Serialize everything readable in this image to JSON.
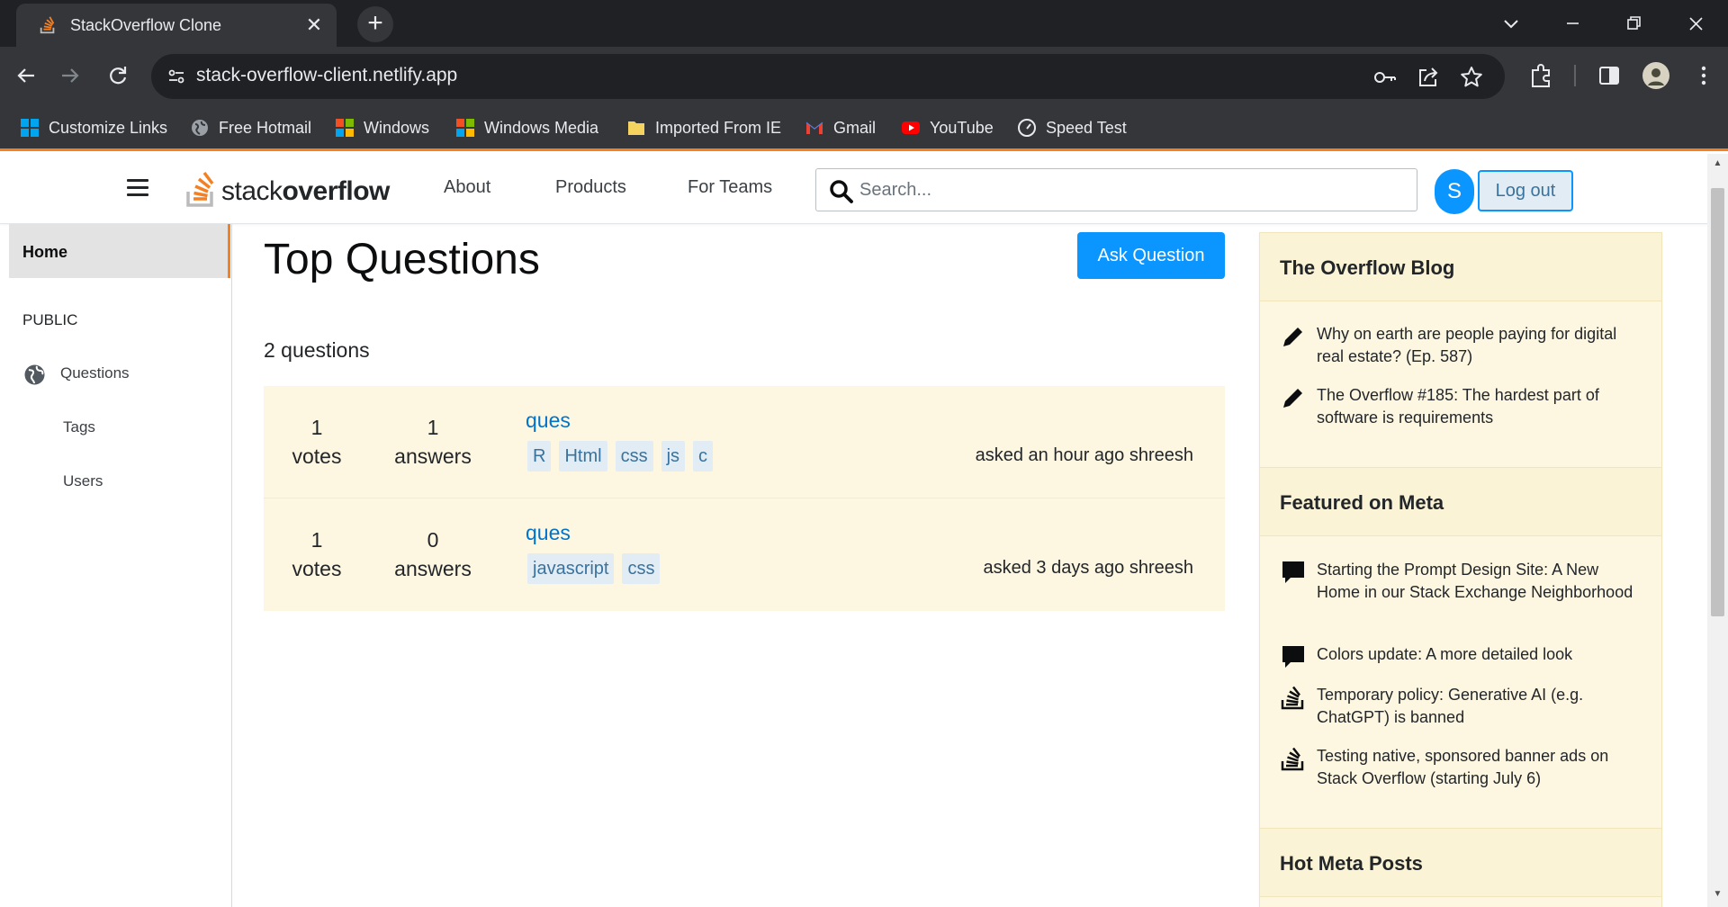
{
  "browser": {
    "tab_title": "StackOverflow Clone",
    "tab_close": "✕",
    "new_tab": "+",
    "url": "stack-overflow-client.netlify.app",
    "bookmarks": [
      "Customize Links",
      "Free Hotmail",
      "Windows",
      "Windows Media",
      "Imported From IE",
      "Gmail",
      "YouTube",
      "Speed Test"
    ]
  },
  "header": {
    "logo_light": "stack",
    "logo_bold": "overflow",
    "nav": [
      "About",
      "Products",
      "For Teams"
    ],
    "search_placeholder": "Search...",
    "avatar_initial": "S",
    "logout_label": "Log out"
  },
  "sidebar": {
    "home": "Home",
    "section": "PUBLIC",
    "items": [
      "Questions",
      "Tags",
      "Users"
    ]
  },
  "main": {
    "title": "Top Questions",
    "ask_button": "Ask Question",
    "count_text": "2 questions",
    "questions": [
      {
        "votes": "1",
        "votes_label": "votes",
        "answers": "1",
        "answers_label": "answers",
        "title": "ques",
        "tags": [
          "R",
          "Html",
          "css",
          "js",
          "c"
        ],
        "asked": "asked an hour ago shreesh"
      },
      {
        "votes": "1",
        "votes_label": "votes",
        "answers": "0",
        "answers_label": "answers",
        "title": "ques",
        "tags": [
          "javascript",
          "css"
        ],
        "asked": "asked 3 days ago shreesh"
      }
    ]
  },
  "right_sidebar": {
    "blog_title": "The Overflow Blog",
    "blog_items": [
      "Why on earth are people paying for digital real estate? (Ep. 587)",
      "The Overflow #185: The hardest part of software is requirements"
    ],
    "meta_title": "Featured on Meta",
    "meta_items": [
      "Starting the Prompt Design Site: A New Home in our Stack Exchange Neighborhood",
      "Colors update: A more detailed look",
      "Temporary policy: Generative AI (e.g. ChatGPT) is banned",
      "Testing native, sponsored banner ads on Stack Overflow (starting July 6)"
    ],
    "hot_title": "Hot Meta Posts"
  },
  "colors": {
    "accent": "#f48024",
    "primary": "#0a95ff",
    "link": "#0074cc",
    "widget_bg": "#fdf7e2"
  }
}
